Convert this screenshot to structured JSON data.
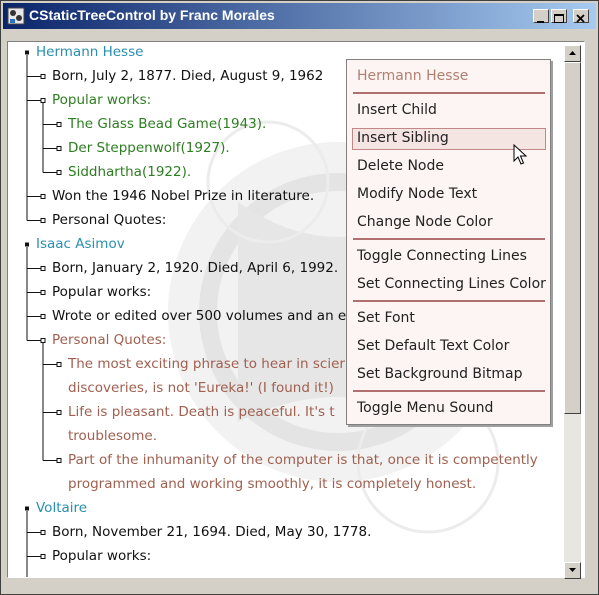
{
  "window": {
    "title": "CStaticTreeControl by Franc Morales"
  },
  "tree": {
    "nodes": [
      {
        "text": "Hermann Hesse",
        "color": "#2a8fb0"
      },
      {
        "text": "Born, July 2, 1877. Died, August 9, 1962",
        "color": "#111111"
      },
      {
        "text": "Popular works:",
        "color": "#2e7d22"
      },
      {
        "text": "The Glass Bead Game(1943).",
        "color": "#2e7d22"
      },
      {
        "text": "Der Steppenwolf(1927).",
        "color": "#2e7d22"
      },
      {
        "text": "Siddhartha(1922).",
        "color": "#2e7d22"
      },
      {
        "text": "Won the 1946 Nobel Prize in literature.",
        "color": "#111111"
      },
      {
        "text": "Personal Quotes:",
        "color": "#111111"
      },
      {
        "text": "Isaac Asimov",
        "color": "#2a8fb0"
      },
      {
        "text": "Born, January 2, 1920. Died, April 6, 1992.",
        "color": "#111111"
      },
      {
        "text": "Popular works:",
        "color": "#111111"
      },
      {
        "text": "Wrote or edited over 500 volumes and an e",
        "color": "#111111"
      },
      {
        "text": "Personal Quotes:",
        "color": "#a06050"
      },
      {
        "text": "The most exciting phrase to hear in scier",
        "color": "#a06050"
      },
      {
        "text": "discoveries, is not 'Eureka!' (I found it!)",
        "color": "#a06050"
      },
      {
        "text": "Life is pleasant. Death is peaceful. It's t",
        "color": "#a06050"
      },
      {
        "text": "troublesome.",
        "color": "#a06050"
      },
      {
        "text": "Part of the inhumanity of the computer is that, once it is competently",
        "color": "#a06050"
      },
      {
        "text": "programmed and working smoothly, it is completely honest.",
        "color": "#a06050"
      },
      {
        "text": "Voltaire",
        "color": "#2a8fb0"
      },
      {
        "text": "Born, November 21, 1694. Died, May 30, 1778.",
        "color": "#111111"
      },
      {
        "text": "Popular works:",
        "color": "#111111"
      }
    ]
  },
  "menu": {
    "header": "Hermann Hesse",
    "items": [
      "Insert Child",
      "Insert Sibling",
      "Delete Node",
      "Modify Node Text",
      "Change Node Color",
      "Toggle Connecting Lines",
      "Set Connecting Lines Color",
      "Set Font",
      "Set Default Text Color",
      "Set Background Bitmap",
      "Toggle Menu Sound"
    ],
    "highlighted": "Insert Sibling"
  },
  "icons": {
    "minimize": "minimize-icon",
    "maximize": "maximize-icon",
    "close": "close-icon",
    "scroll_up": "scroll-up-arrow-icon",
    "scroll_down": "scroll-down-arrow-icon",
    "app": "app-icon",
    "cursor": "mouse-pointer-icon"
  }
}
